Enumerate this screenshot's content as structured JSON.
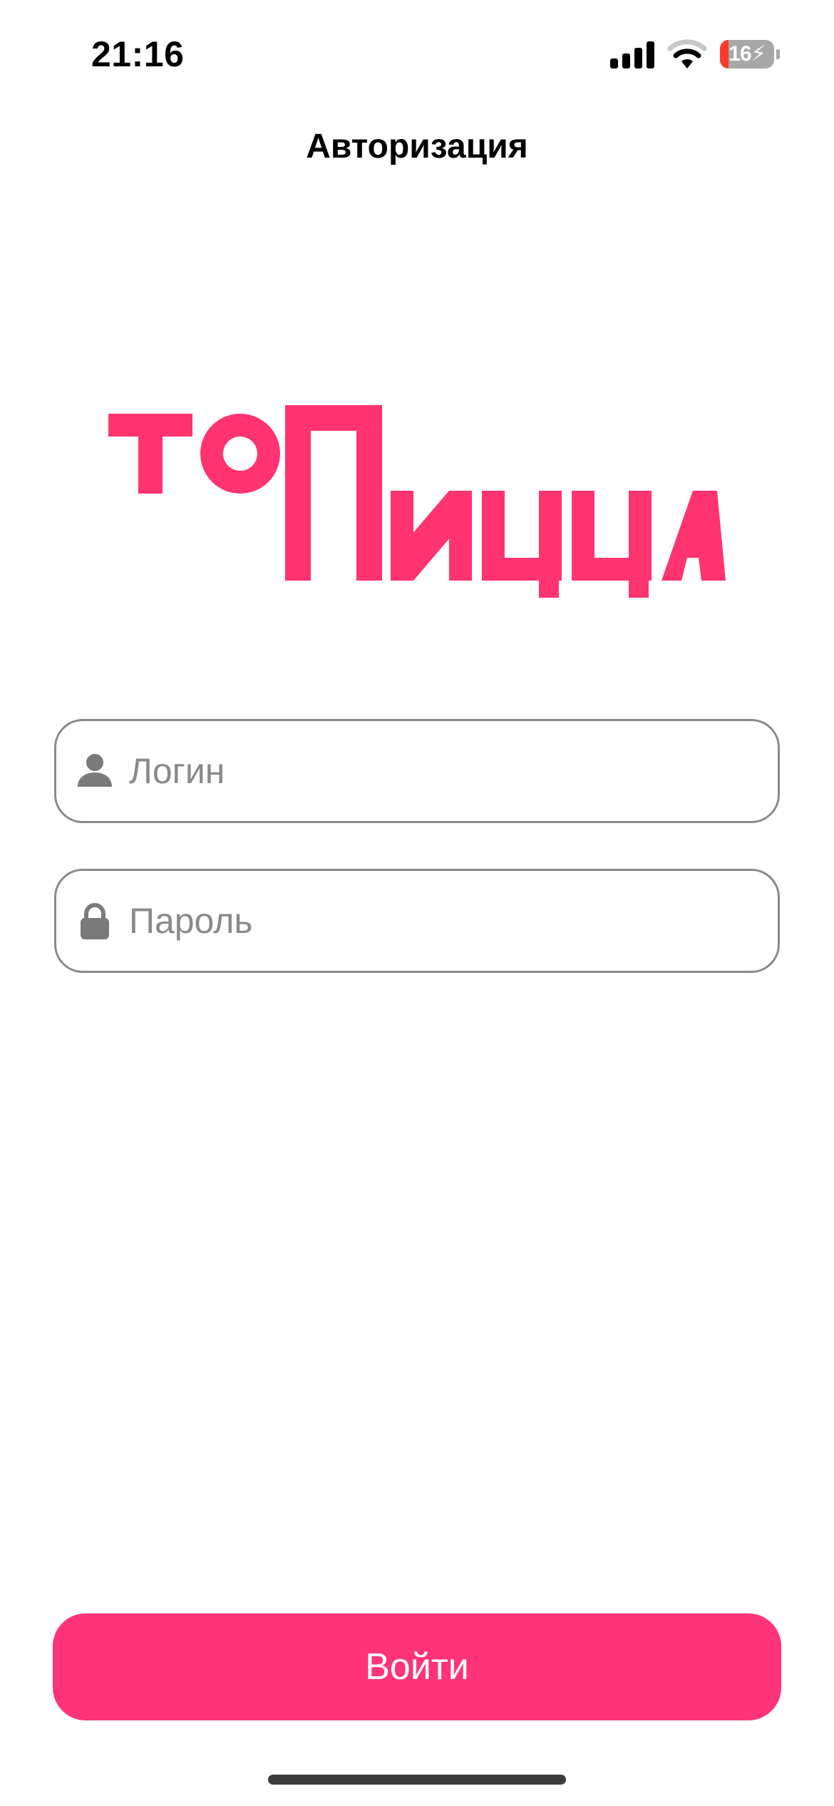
{
  "status_bar": {
    "time": "21:16",
    "battery_level": "16",
    "battery_fraction": 0.16,
    "battery_charging": true,
    "signal_icon": "cellular-signal-icon",
    "wifi_icon": "wifi-icon",
    "battery_icon": "battery-charging-icon"
  },
  "nav": {
    "title": "Авторизация"
  },
  "logo": {
    "text_top": "ТО",
    "text_bottom": "ПИЦЦА",
    "color": "#ff3370"
  },
  "form": {
    "login": {
      "icon": "person-icon",
      "placeholder": "Логин",
      "value": ""
    },
    "password": {
      "icon": "lock-icon",
      "placeholder": "Пароль",
      "value": ""
    },
    "submit_label": "Войти"
  },
  "colors": {
    "accent": "#ff3378",
    "field_border": "#8a8a8a",
    "placeholder": "#8a8a8a"
  }
}
